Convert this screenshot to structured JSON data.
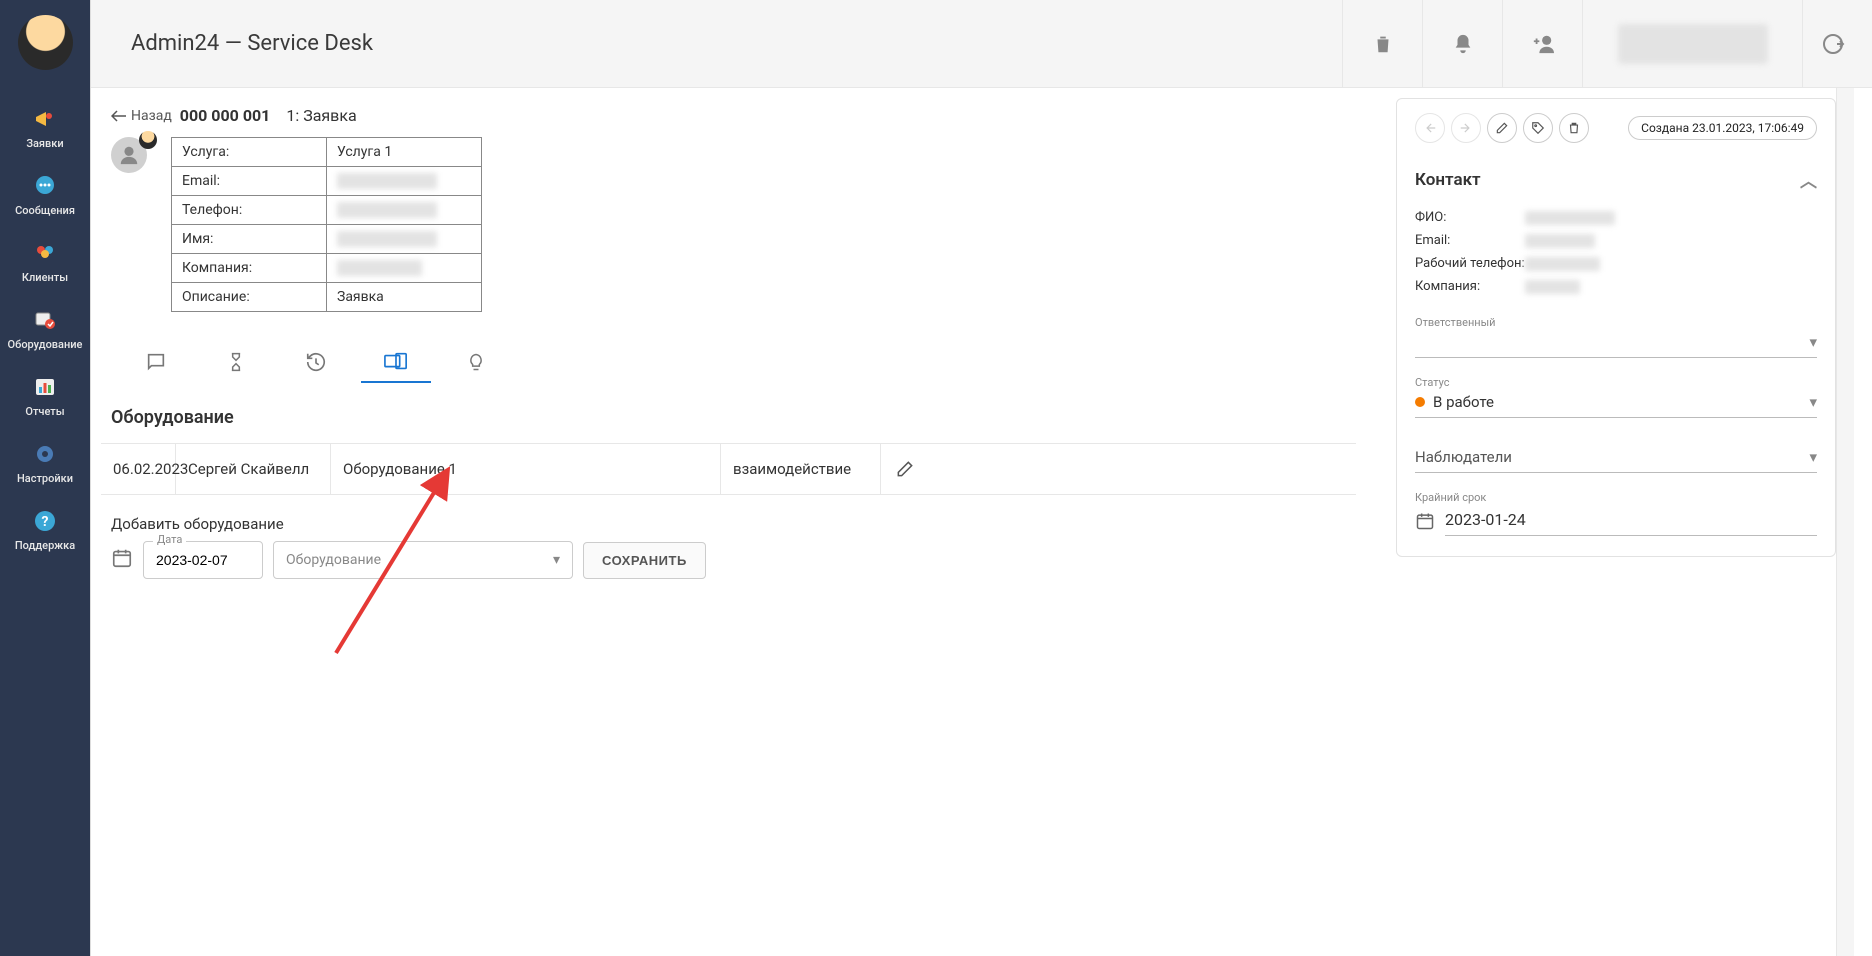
{
  "app_title": "Admin24 — Service Desk",
  "sidebar": {
    "items": [
      {
        "label": "Заявки"
      },
      {
        "label": "Сообщения"
      },
      {
        "label": "Клиенты"
      },
      {
        "label": "Оборудование"
      },
      {
        "label": "Отчеты"
      },
      {
        "label": "Настройки"
      },
      {
        "label": "Поддержка"
      }
    ]
  },
  "back": {
    "label": "Назад",
    "id": "000 000 001",
    "title": "1: Заявка"
  },
  "ticket_fields": {
    "service_label": "Услуга:",
    "service_value": "Услуга 1",
    "email_label": "Email:",
    "phone_label": "Телефон:",
    "name_label": "Имя:",
    "company_label": "Компания:",
    "desc_label": "Описание:",
    "desc_value": "Заявка"
  },
  "equipment": {
    "section_title": "Оборудование",
    "row": {
      "date": "06.02.2023",
      "user": "Сергей Скайвелл",
      "name": "Оборудование 1",
      "interaction": "взаимодействие"
    },
    "add_label": "Добавить оборудование",
    "date_field_label": "Дата",
    "date_value": "2023-02-07",
    "select_placeholder": "Оборудование",
    "save_btn": "СОХРАНИТЬ"
  },
  "right": {
    "created_label": "Создана 23.01.2023, 17:06:49",
    "contact_title": "Контакт",
    "fio_label": "ФИО:",
    "email_label": "Email:",
    "phone_label": "Рабочий телефон:",
    "company_label": "Компания:",
    "responsible_label": "Ответственный",
    "status_label": "Статус",
    "status_value": "В работе",
    "watchers_label": "Наблюдатели",
    "deadline_label": "Крайний срок",
    "deadline_value": "2023-01-24"
  }
}
